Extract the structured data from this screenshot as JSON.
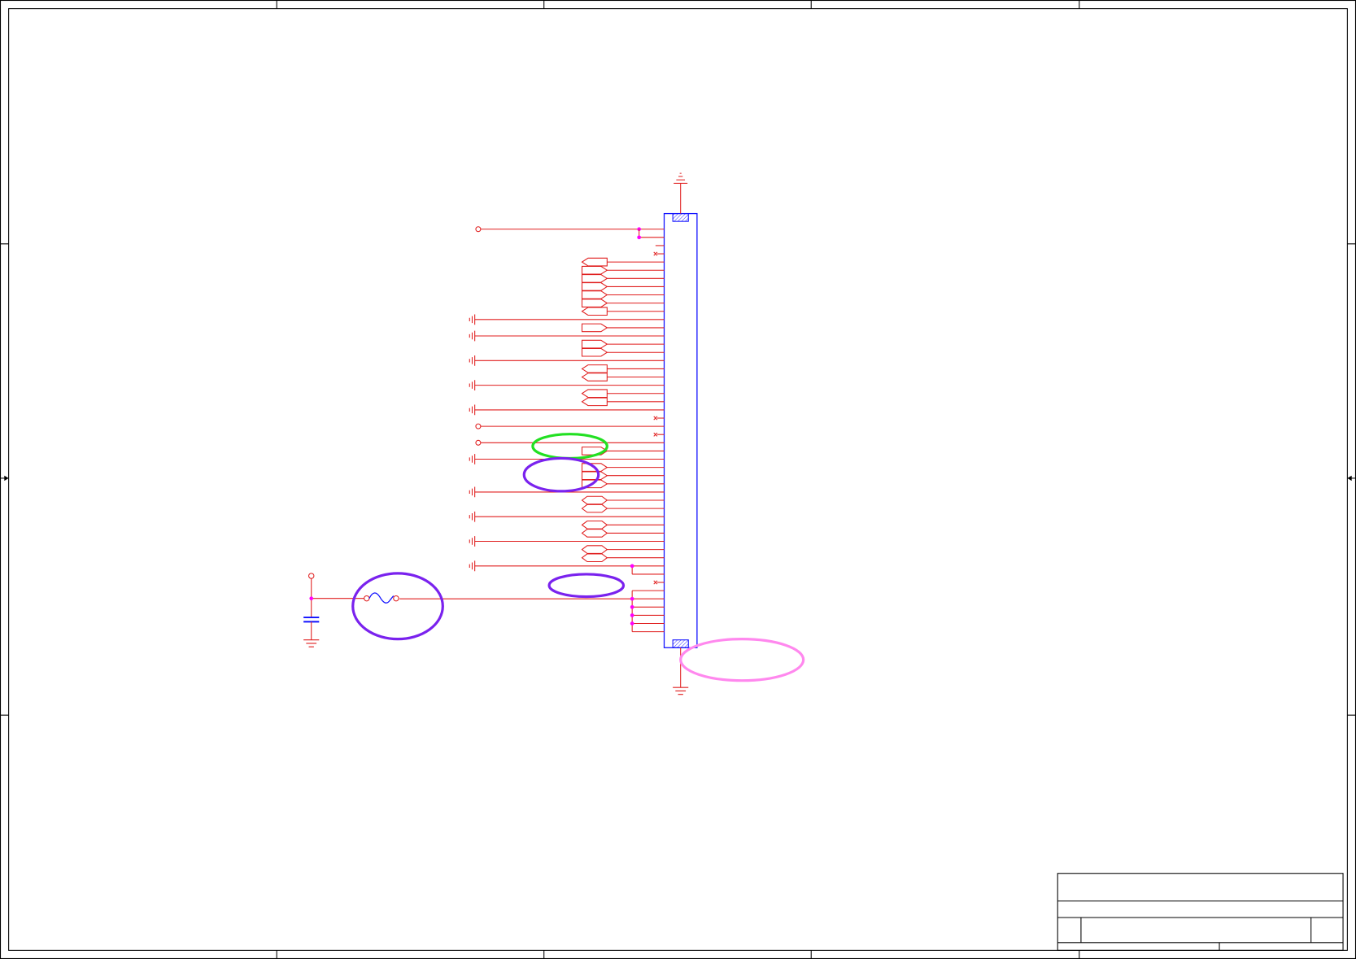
{
  "colors": {
    "background": "#ffffff",
    "border": "#000000",
    "wire": "#e01e1e",
    "component": "#1010ff",
    "junction": "#ff00ff",
    "highlight_green": "#22e022",
    "highlight_purple": "#7a22ee",
    "highlight_pink": "#ff88ee"
  },
  "icons": {
    "ground": "ground-icon",
    "fuse": "fuse-icon",
    "capacitor": "capacitor-icon",
    "port": "off-page-port-icon",
    "terminal": "open-terminal-icon",
    "no_connect": "no-connect-icon"
  }
}
